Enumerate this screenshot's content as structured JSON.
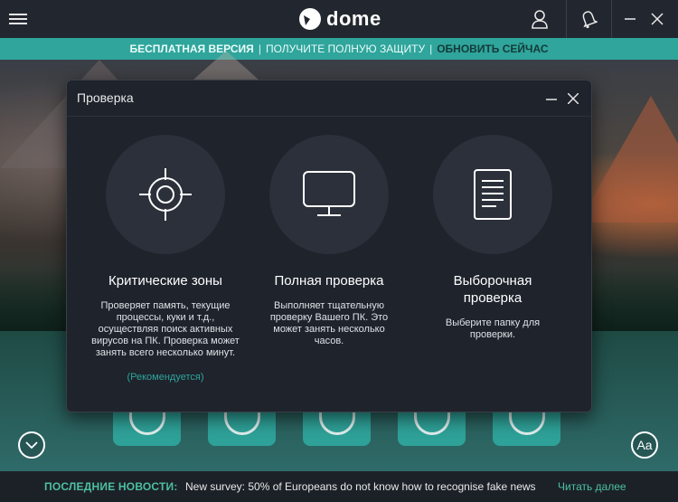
{
  "app": {
    "brand_text": "dome",
    "brand_color": "#ffffff",
    "accent_color": "#2fa59c"
  },
  "promo": {
    "free_label": "БЕСПЛАТНАЯ ВЕРСИЯ",
    "separator": "|",
    "get_protection": "ПОЛУЧИТЕ ПОЛНУЮ ЗАЩИТУ",
    "upgrade_label": "ОБНОВИТЬ СЕЙЧАС"
  },
  "dialog": {
    "title": "Проверка",
    "options": [
      {
        "icon": "crosshair-icon",
        "title": "Критические зоны",
        "description": "Проверяет память, текущие процессы, куки и т.д., осуществляя поиск активных вирусов на ПК. Проверка может занять всего несколько минут.",
        "recommended": "(Рекомендуется)"
      },
      {
        "icon": "monitor-icon",
        "title": "Полная проверка",
        "description": "Выполняет тщательную проверку Вашего ПК. Это может занять несколько часов."
      },
      {
        "icon": "document-icon",
        "title": "Выборочная проверка",
        "description": "Выберите папку для проверки."
      }
    ]
  },
  "font_button": "Aa",
  "news": {
    "label": "ПОСЛЕДНИЕ НОВОСТИ:",
    "headline": "New survey: 50% of Europeans do not know how to recognise fake news",
    "read_more": "Читать далее"
  }
}
